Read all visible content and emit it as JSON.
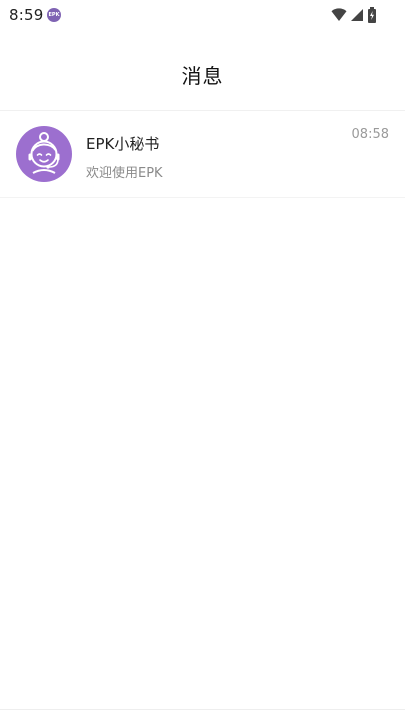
{
  "status_bar": {
    "time": "8:59",
    "app_icon_text": "EPK"
  },
  "header": {
    "title": "消息"
  },
  "messages": [
    {
      "name": "EPK小秘书",
      "preview": "欢迎使用EPK",
      "time": "08:58",
      "avatar_color": "#9c6fcf"
    }
  ],
  "colors": {
    "accent": "#9c6fcf",
    "status_icon": "#7f63b3"
  },
  "icons": {
    "status": [
      "wifi-icon",
      "cell-signal-icon",
      "battery-icon"
    ],
    "avatar": "customer-service-avatar-icon"
  }
}
